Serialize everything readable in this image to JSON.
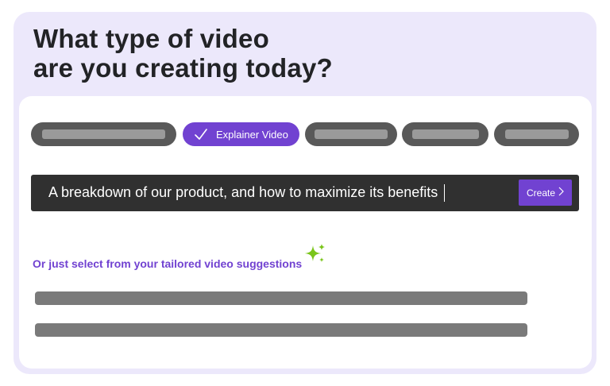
{
  "header": {
    "title_line1": "What type of video",
    "title_line2": "are you creating today?"
  },
  "video_types": {
    "selected_label": "Explainer Video"
  },
  "prompt": {
    "value": "A breakdown of our product, and how to maximize its benefits",
    "create_label": "Create"
  },
  "suggestions": {
    "label": "Or just select from your tailored video suggestions"
  },
  "colors": {
    "accent": "#7142d1",
    "sparkle": "#7ac51a",
    "card_bg": "#ece8fb"
  },
  "icons": [
    "check-icon",
    "chevron-right-icon",
    "sparkle-icon"
  ]
}
